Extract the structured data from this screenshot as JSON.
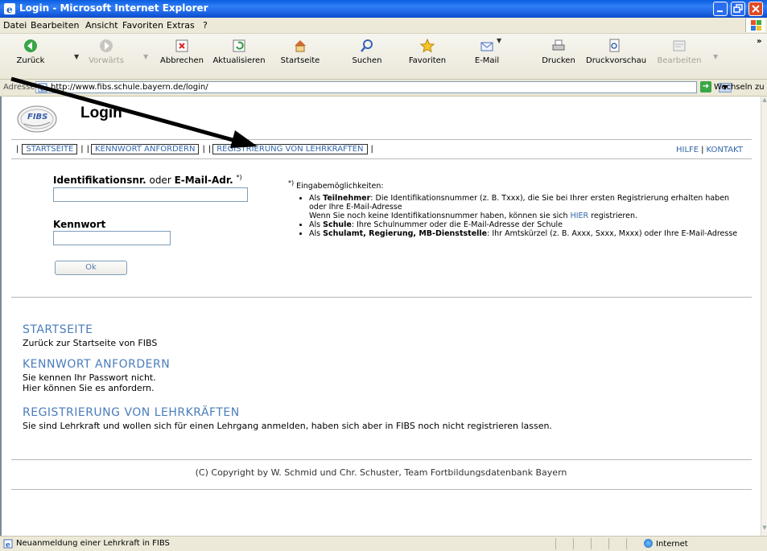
{
  "window": {
    "title": "Login - Microsoft Internet Explorer"
  },
  "menu": [
    "Datei",
    "Bearbeiten",
    "Ansicht",
    "Favoriten",
    "Extras",
    "?"
  ],
  "toolbar": {
    "back": "Zurück",
    "forward": "Vorwärts",
    "stop": "Abbrechen",
    "refresh": "Aktualisieren",
    "home": "Startseite",
    "search": "Suchen",
    "favorites": "Favoriten",
    "mail": "E-Mail",
    "print": "Drucken",
    "preview": "Druckvorschau",
    "edit": "Bearbeiten"
  },
  "address": {
    "label": "Adresse",
    "url": "http://www.fibs.schule.bayern.de/login/",
    "go": "Wechseln zu"
  },
  "page": {
    "logo": "FIBS",
    "title": "Login",
    "nav": [
      "STARTSEITE",
      "KENNWORT ANFORDERN",
      "REGISTRIERUNG VON LEHRKRÄFTEN"
    ],
    "nav_right": [
      "HILFE",
      "KONTAKT"
    ],
    "form": {
      "id_label_bold1": "Identifikationsnr.",
      "id_label_or": " oder ",
      "id_label_bold2": "E-Mail-Adr.",
      "id_label_sup": "*)",
      "id_value": "",
      "pw_label": "Kennwort",
      "pw_value": "",
      "ok": "Ok"
    },
    "hint": {
      "sup": "*)",
      "head": " Eingabemöglichkeiten:",
      "item1_pre": "Als ",
      "item1_bold": "Teilnehmer",
      "item1_text": ": Die Identifikationsnummer (z. B. Txxx), die Sie bei Ihrer ersten Registrierung erhalten haben oder Ihre E-Mail-Adresse",
      "item1_line2_pre": "Wenn Sie noch keine Identifikationsnummer haben, können sie sich ",
      "item1_link": "HIER",
      "item1_line2_post": " registrieren.",
      "item2_pre": "Als ",
      "item2_bold": "Schule",
      "item2_text": ": Ihre Schulnummer oder die E-Mail-Adresse der Schule",
      "item3_pre": "Als ",
      "item3_bold": "Schulamt, Regierung, MB-Dienststelle",
      "item3_text": ": Ihr Amtskürzel (z. B. Axxx, Sxxx, Mxxx) oder Ihre E-Mail-Adresse"
    },
    "sections": [
      {
        "title": "STARTSEITE",
        "text": [
          "Zurück zur Startseite von FIBS"
        ]
      },
      {
        "title": "KENNWORT ANFORDERN",
        "text": [
          "Sie kennen Ihr Passwort nicht.",
          "Hier können Sie es anfordern."
        ]
      },
      {
        "title": "REGISTRIERUNG VON LEHRKRÄFTEN",
        "text": [
          "Sie sind Lehrkraft und wollen sich für einen Lehrgang anmelden, haben sich aber in FIBS noch nicht registrieren lassen."
        ]
      }
    ],
    "copyright": "(C) Copyright by W. Schmid und Chr. Schuster, Team Fortbildungsdatenbank Bayern"
  },
  "status": {
    "message": "Neuanmeldung einer Lehrkraft in FIBS",
    "zone": "Internet"
  },
  "colors": {
    "link": "#3366aa",
    "section_title": "#4a7dbc",
    "titlebar": "#0a5de0"
  }
}
